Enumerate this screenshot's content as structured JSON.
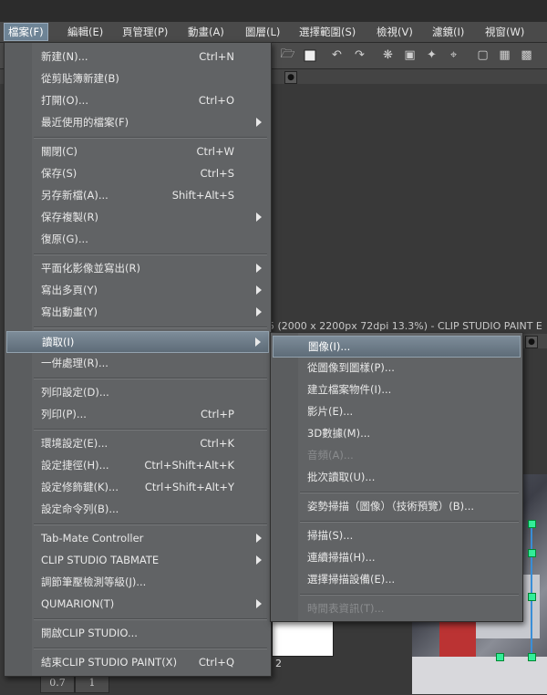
{
  "menubar": [
    {
      "label": "檔案(F)",
      "active": true
    },
    {
      "label": "編輯(E)"
    },
    {
      "label": "頁管理(P)"
    },
    {
      "label": "動畫(A)"
    },
    {
      "label": "圖層(L)"
    },
    {
      "label": "選擇範圍(S)"
    },
    {
      "label": "檢視(V)"
    },
    {
      "label": "濾鏡(I)"
    },
    {
      "label": "視窗(W)"
    }
  ],
  "document_title": "5 (2000 x 2200px 72dpi 13.3%)  - CLIP STUDIO PAINT E",
  "thumbnail_page_number": "2",
  "zoom_cells": [
    "0.7",
    "1"
  ],
  "file_menu": {
    "items": [
      {
        "label": "新建(N)...",
        "shortcut": "Ctrl+N"
      },
      {
        "label": "從剪貼簿新建(B)",
        "shortcut": ""
      },
      {
        "label": "打開(O)...",
        "shortcut": "Ctrl+O"
      },
      {
        "label": "最近使用的檔案(F)",
        "shortcut": "",
        "submenu": true
      },
      {
        "label": "關閉(C)",
        "shortcut": "Ctrl+W"
      },
      {
        "label": "保存(S)",
        "shortcut": "Ctrl+S"
      },
      {
        "label": "另存新檔(A)...",
        "shortcut": "Shift+Alt+S"
      },
      {
        "label": "保存複製(R)",
        "shortcut": "",
        "submenu": true
      },
      {
        "label": "復原(G)...",
        "shortcut": ""
      },
      {
        "label": "平面化影像並寫出(R)",
        "shortcut": "",
        "submenu": true
      },
      {
        "label": "寫出多頁(Y)",
        "shortcut": "",
        "submenu": true
      },
      {
        "label": "寫出動畫(Y)",
        "shortcut": "",
        "submenu": true
      },
      {
        "label": "讀取(I)",
        "shortcut": "",
        "submenu": true,
        "highlighted": true
      },
      {
        "label": "一併處理(R)...",
        "shortcut": ""
      },
      {
        "label": "列印設定(D)...",
        "shortcut": ""
      },
      {
        "label": "列印(P)...",
        "shortcut": "Ctrl+P"
      },
      {
        "label": "環境設定(E)...",
        "shortcut": "Ctrl+K"
      },
      {
        "label": "設定捷徑(H)...",
        "shortcut": "Ctrl+Shift+Alt+K"
      },
      {
        "label": "設定修飾鍵(K)...",
        "shortcut": "Ctrl+Shift+Alt+Y"
      },
      {
        "label": "設定命令列(B)...",
        "shortcut": ""
      },
      {
        "label": "Tab-Mate Controller",
        "shortcut": "",
        "submenu": true
      },
      {
        "label": "CLIP STUDIO TABMATE",
        "shortcut": "",
        "submenu": true
      },
      {
        "label": "調節筆壓檢測等級(J)...",
        "shortcut": ""
      },
      {
        "label": "QUMARION(T)",
        "shortcut": "",
        "submenu": true
      },
      {
        "label": "開啟CLIP STUDIO...",
        "shortcut": ""
      },
      {
        "label": "結束CLIP STUDIO PAINT(X)",
        "shortcut": "Ctrl+Q"
      }
    ]
  },
  "import_submenu": {
    "items": [
      {
        "label": "圖像(I)...",
        "highlighted": true
      },
      {
        "label": "從圖像到圖樣(P)..."
      },
      {
        "label": "建立檔案物件(I)..."
      },
      {
        "label": "影片(E)..."
      },
      {
        "label": "3D數據(M)..."
      },
      {
        "label": "音頻(A)...",
        "disabled": true
      },
      {
        "label": "批次讀取(U)..."
      },
      {
        "label": "姿勢掃描（圖像）（技術預覽）(B)..."
      },
      {
        "label": "掃描(S)..."
      },
      {
        "label": "連續掃描(H)..."
      },
      {
        "label": "選擇掃描設備(E)..."
      },
      {
        "label": "時間表資訊(T)...",
        "disabled": true
      }
    ]
  }
}
